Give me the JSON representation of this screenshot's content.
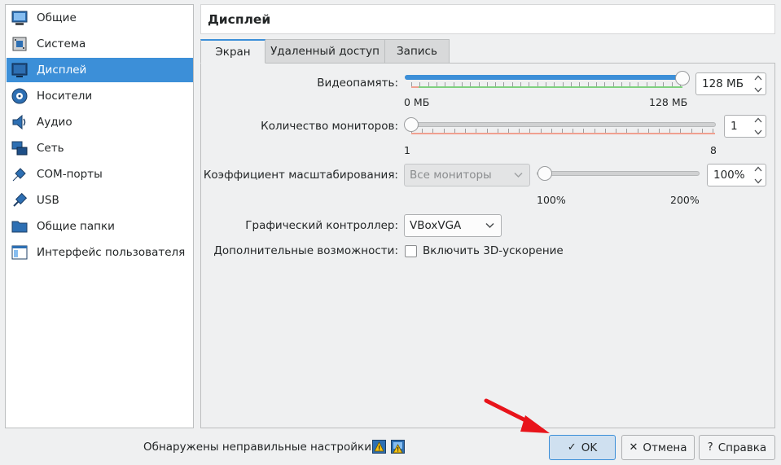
{
  "sidebar": {
    "items": [
      {
        "label": "Общие",
        "icon": "general-icon"
      },
      {
        "label": "Система",
        "icon": "system-icon"
      },
      {
        "label": "Дисплей",
        "icon": "display-icon",
        "active": true
      },
      {
        "label": "Носители",
        "icon": "storage-icon"
      },
      {
        "label": "Аудио",
        "icon": "audio-icon"
      },
      {
        "label": "Сеть",
        "icon": "network-icon"
      },
      {
        "label": "COM-порты",
        "icon": "serial-ports-icon"
      },
      {
        "label": "USB",
        "icon": "usb-icon"
      },
      {
        "label": "Общие папки",
        "icon": "shared-folders-icon"
      },
      {
        "label": "Интерфейс пользователя",
        "icon": "user-interface-icon"
      }
    ]
  },
  "header": {
    "title": "Дисплей"
  },
  "tabs": [
    {
      "label": "Экран",
      "active": true
    },
    {
      "label": "Удаленный доступ"
    },
    {
      "label": "Запись"
    }
  ],
  "screen": {
    "video_memory": {
      "label": "Видеопамять:",
      "value": "128 МБ",
      "min_label": "0 МБ",
      "max_label": "128 МБ",
      "fraction": 1.0
    },
    "monitors": {
      "label": "Количество мониторов:",
      "value": "1",
      "min_label": "1",
      "max_label": "8",
      "fraction": 0.0
    },
    "scale": {
      "label": "Коэффициент масштабирования:",
      "combo_value": "Все мониторы",
      "value": "100%",
      "min_label": "100%",
      "max_label": "200%",
      "fraction": 0.0
    },
    "controller": {
      "label": "Графический контроллер:",
      "value": "VBoxVGA"
    },
    "extras": {
      "label": "Дополнительные возможности:",
      "checkbox_label": "Включить 3D-ускорение",
      "checked": false
    }
  },
  "footer": {
    "warning": "Обнаружены неправильные настройки",
    "ok_label": "OK",
    "cancel_label": "Отмена",
    "help_label": "Справка"
  },
  "colors": {
    "accent": "#3c8fd8",
    "annotation_arrow": "#e8141b",
    "good_zone": "#7fd17f",
    "bad_zone": "#f0a090"
  }
}
